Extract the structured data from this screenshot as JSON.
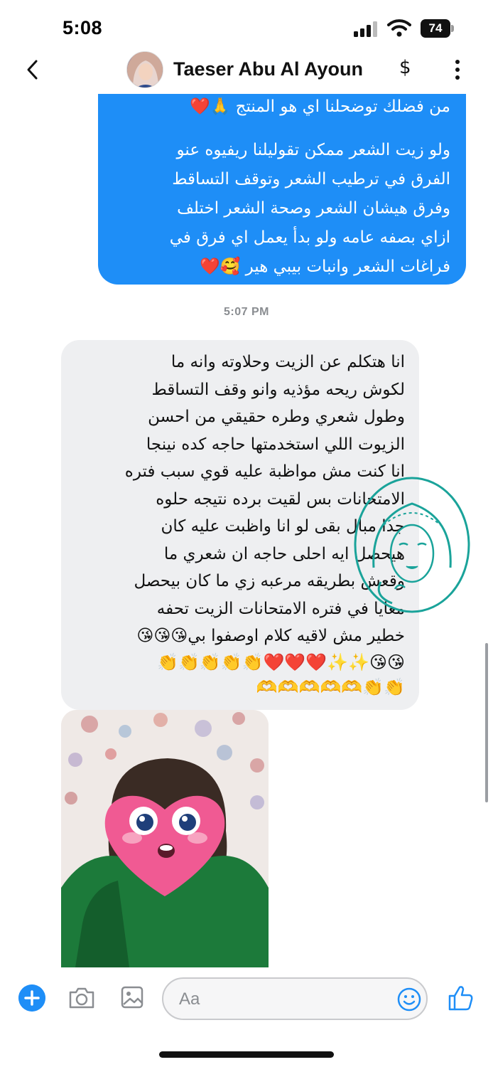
{
  "status_bar": {
    "time": "5:08",
    "battery": "74"
  },
  "header": {
    "contact_name": "Taeser Abu Al Ayoun",
    "dollar": "$"
  },
  "messages": {
    "outgoing": {
      "text_1": "من فضلك توضحلنا اي هو المنتج 🙏❤️",
      "text_2": "ولو زيت الشعر ممكن تقوليلنا ريفيوه عنو\nالفرق في ترطيب الشعر وتوقف التساقط\nوفرق هيشان الشعر وصحة الشعر اختلف\nازاي بصفه عامه ولو بدأ يعمل اي فرق في\nفراغات الشعر وانبات بيبي هير 🥰❤️"
    },
    "timestamp": "5:07 PM",
    "incoming": {
      "text": "انا هتكلم عن الزيت وحلاوته وانه ما\nلكوش ريحه مؤذيه وانو وقف التساقط\nوطول شعري وطره حقيقي من احسن\nالزيوت اللي استخدمتها حاجه كده نينجا\nانا  كنت مش مواظبة عليه قوي سبب فتره\nالامتحانات بس لقيت برده نتيجه حلوه\nجدا مبال بقى لو انا واظبت عليه كان\nهيحصل ايه احلى حاجه ان شعري ما\nوقعش بطريقه مرعبه زي ما كان بيحصل\nمعايا في فتره الامتحانات الزيت تحفه\nخطير مش لاقيه كلام اوصفوا بي😘😘😘",
      "emoji_line_1": "😘😘✨✨❤️❤️❤️👏👏👏👏👏",
      "emoji_line_2": "👏👏🫶🫶🫶🫶🫶"
    }
  },
  "composer": {
    "placeholder": "Aa"
  },
  "colors": {
    "outgoing_bubble": "#1e8ef7",
    "incoming_bubble": "#eeeff1",
    "accent": "#1e8ef7"
  }
}
